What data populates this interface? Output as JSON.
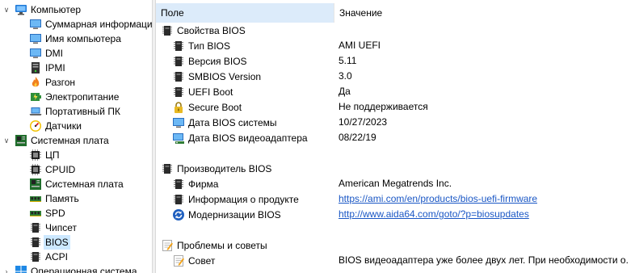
{
  "tree": {
    "items": [
      {
        "label": "Компьютер",
        "icon": "computer-icon",
        "chevron": "down"
      },
      {
        "label": "Суммарная информация",
        "icon": "monitor-icon"
      },
      {
        "label": "Имя компьютера",
        "icon": "monitor-icon"
      },
      {
        "label": "DMI",
        "icon": "monitor-icon"
      },
      {
        "label": "IPMI",
        "icon": "server-icon"
      },
      {
        "label": "Разгон",
        "icon": "flame-icon"
      },
      {
        "label": "Электропитание",
        "icon": "power-icon"
      },
      {
        "label": "Портативный ПК",
        "icon": "laptop-icon"
      },
      {
        "label": "Датчики",
        "icon": "gauge-icon"
      },
      {
        "label": "Системная плата",
        "icon": "motherboard-icon",
        "chevron": "down"
      },
      {
        "label": "ЦП",
        "icon": "cpu-icon"
      },
      {
        "label": "CPUID",
        "icon": "cpu-icon"
      },
      {
        "label": "Системная плата",
        "icon": "motherboard-icon"
      },
      {
        "label": "Память",
        "icon": "memory-icon"
      },
      {
        "label": "SPD",
        "icon": "memory-icon"
      },
      {
        "label": "Чипсет",
        "icon": "chip-icon"
      },
      {
        "label": "BIOS",
        "icon": "chip-icon",
        "selected": true
      },
      {
        "label": "ACPI",
        "icon": "chip-icon"
      },
      {
        "label": "Операционная система",
        "icon": "windows-icon",
        "chevron": "right"
      }
    ]
  },
  "table": {
    "col_field": "Поле",
    "col_value": "Значение",
    "rows": [
      {
        "type": "section",
        "field": "Свойства BIOS",
        "icon": "chip-icon"
      },
      {
        "type": "item",
        "field": "Тип BIOS",
        "icon": "chip-icon",
        "value": "AMI UEFI"
      },
      {
        "type": "item",
        "field": "Версия BIOS",
        "icon": "chip-icon",
        "value": "5.11"
      },
      {
        "type": "item",
        "field": "SMBIOS Version",
        "icon": "chip-icon",
        "value": "3.0"
      },
      {
        "type": "item",
        "field": "UEFI Boot",
        "icon": "chip-icon",
        "value": "Да"
      },
      {
        "type": "item",
        "field": "Secure Boot",
        "icon": "lock-icon",
        "value": "Не поддерживается"
      },
      {
        "type": "item",
        "field": "Дата BIOS системы",
        "icon": "monitor-icon",
        "value": "10/27/2023"
      },
      {
        "type": "item",
        "field": "Дата BIOS видеоадаптера",
        "icon": "display-adapter-icon",
        "value": "08/22/19"
      },
      {
        "type": "blank"
      },
      {
        "type": "section",
        "field": "Производитель BIOS",
        "icon": "chip-icon"
      },
      {
        "type": "item",
        "field": "Фирма",
        "icon": "chip-icon",
        "value": "American Megatrends Inc."
      },
      {
        "type": "item",
        "field": "Информация о продукте",
        "icon": "chip-icon",
        "value": "https://ami.com/en/products/bios-uefi-firmware",
        "link": true
      },
      {
        "type": "item",
        "field": "Модернизации BIOS",
        "icon": "update-icon",
        "value": "http://www.aida64.com/goto/?p=biosupdates",
        "link": true
      },
      {
        "type": "blank"
      },
      {
        "type": "section",
        "field": "Проблемы и советы",
        "icon": "note-icon"
      },
      {
        "type": "item",
        "field": "Совет",
        "icon": "note-icon",
        "value": "BIOS видеоадаптера уже более двух лет. При необходимости о..."
      }
    ]
  }
}
